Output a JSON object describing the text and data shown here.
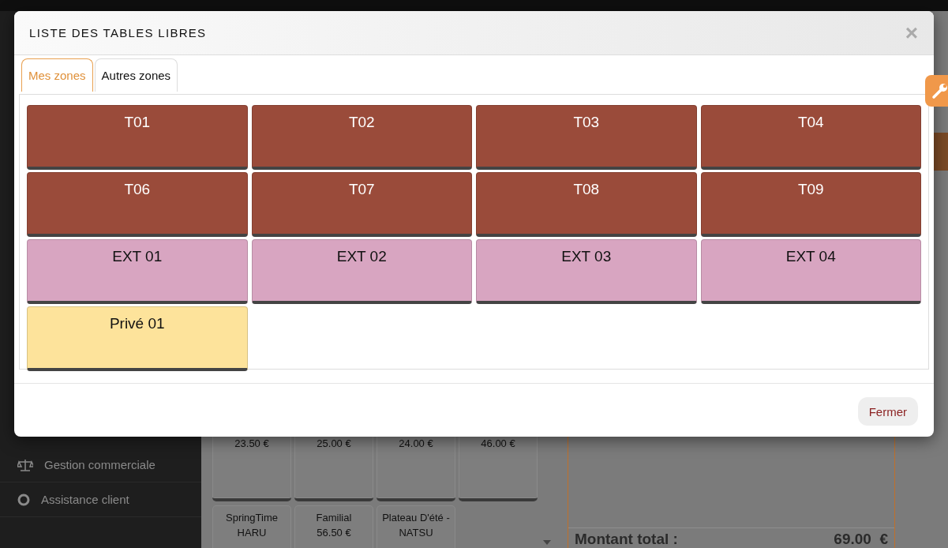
{
  "sidebar": {
    "items": [
      {
        "label": "Gestion commerciale",
        "kind": "scale"
      },
      {
        "label": "Assistance client",
        "kind": "lifebuoy"
      }
    ]
  },
  "products": [
    {
      "price": "23.50 €"
    },
    {
      "price": "25.00 €"
    },
    {
      "price": "24.00 €"
    },
    {
      "price": "46.00 €"
    },
    {
      "name": "SpringTime HARU"
    },
    {
      "name": "Familial",
      "price": "56.50 €"
    },
    {
      "name": "Plateau D'été - NATSU"
    }
  ],
  "order": {
    "total_label": "Montant total :",
    "total_value": "69.00  €"
  },
  "modal": {
    "title": "LISTE DES TABLES LIBRES",
    "close": "×",
    "tabs": [
      {
        "label": "Mes zones",
        "selected": true
      },
      {
        "label": "Autres zones",
        "selected": false
      }
    ],
    "tables": [
      {
        "label": "T01",
        "color": "#9a4b3a"
      },
      {
        "label": "T02",
        "color": "#9a4b3a"
      },
      {
        "label": "T03",
        "color": "#9a4b3a"
      },
      {
        "label": "T04",
        "color": "#9a4b3a"
      },
      {
        "label": "T06",
        "color": "#9a4b3a"
      },
      {
        "label": "T07",
        "color": "#9a4b3a"
      },
      {
        "label": "T08",
        "color": "#9a4b3a"
      },
      {
        "label": "T09",
        "color": "#9a4b3a"
      },
      {
        "label": "EXT 01",
        "color": "#d8a5c1"
      },
      {
        "label": "EXT 02",
        "color": "#d8a5c1"
      },
      {
        "label": "EXT 03",
        "color": "#d8a5c1"
      },
      {
        "label": "EXT 04",
        "color": "#d8a5c1"
      },
      {
        "label": "Privé 01",
        "color": "#fde39b"
      }
    ],
    "footer_button": "Fermer"
  }
}
